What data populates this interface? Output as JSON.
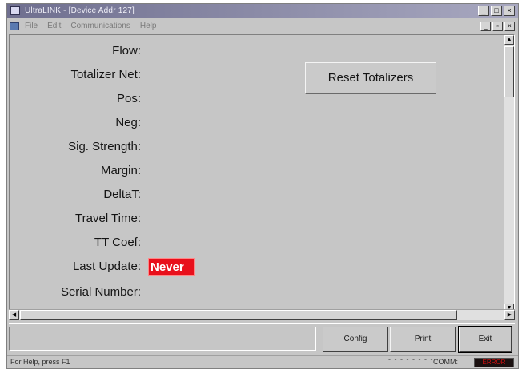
{
  "window": {
    "title": "UltraLINK - [Device Addr 127]",
    "controls": [
      "_",
      "□",
      "×"
    ]
  },
  "menu": {
    "items": [
      "File",
      "Edit",
      "Communications",
      "Help"
    ],
    "mdi_controls": [
      "_",
      "▫",
      "×"
    ]
  },
  "fields": [
    {
      "label": "Flow:"
    },
    {
      "label": "Totalizer Net:"
    },
    {
      "label": "Pos:"
    },
    {
      "label": "Neg:"
    },
    {
      "label": "Sig. Strength:"
    },
    {
      "label": "Margin:"
    },
    {
      "label": "DeltaT:"
    },
    {
      "label": "Travel Time:"
    },
    {
      "label": "TT Coef:"
    },
    {
      "label": "Last Update:",
      "value": "Never"
    },
    {
      "label": "Serial Number:"
    }
  ],
  "reset_button": "Reset Totalizers",
  "buttons": {
    "config": "Config",
    "print": "Print",
    "exit": "Exit"
  },
  "status": {
    "help": "For Help, press F1",
    "dots": "- - - - - - - -",
    "comm_label": "COMM:",
    "comm_value": "ERROR"
  },
  "colors": {
    "face": "#c6c6c6",
    "never_badge": "#e8101c",
    "comm_error": "#d01010"
  },
  "icons": {
    "scroll_up": "▲",
    "scroll_down": "▼",
    "scroll_left": "◀",
    "scroll_right": "▶"
  }
}
